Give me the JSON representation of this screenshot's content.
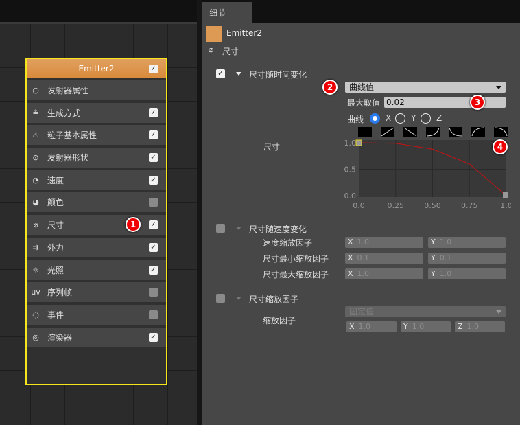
{
  "tab": "细节",
  "node": {
    "title": "Emitter2",
    "enabled": true,
    "modules": [
      {
        "icon": "circle-icon",
        "label": "发射器属性",
        "checkbox": null
      },
      {
        "icon": "sliders-icon",
        "label": "生成方式",
        "checkbox": true
      },
      {
        "icon": "flame-icon",
        "label": "粒子基本属性",
        "checkbox": true
      },
      {
        "icon": "location-pin-icon",
        "label": "发射器形状",
        "checkbox": true
      },
      {
        "icon": "speedometer-icon",
        "label": "速度",
        "checkbox": true
      },
      {
        "icon": "palette-icon",
        "label": "颜色",
        "checkbox": false
      },
      {
        "icon": "ruler-icon",
        "label": "尺寸",
        "checkbox": true,
        "badge": "1"
      },
      {
        "icon": "arrows-icon",
        "label": "外力",
        "checkbox": true
      },
      {
        "icon": "sun-icon",
        "label": "光照",
        "checkbox": true
      },
      {
        "icon": "uv-icon",
        "label": "序列帧",
        "checkbox": false
      },
      {
        "icon": "event-icon",
        "label": "事件",
        "checkbox": false
      },
      {
        "icon": "renderer-icon",
        "label": "渲染器",
        "checkbox": true
      }
    ]
  },
  "details": {
    "emitter_name": "Emitter2",
    "accent": "#dd9a55",
    "module_name": "尺寸",
    "size_over_time": {
      "label": "尺寸随时间变化",
      "enabled": true,
      "mode": "曲线值",
      "badge_mode": "2",
      "max_label": "最大取值",
      "max_value": "0.02",
      "badge_max": "3",
      "curve_label": "曲线",
      "axes": [
        "X",
        "Y",
        "Z"
      ],
      "selected_axis": "X",
      "field_label": "尺寸",
      "badge_curve": "4",
      "chart_data": {
        "type": "line",
        "x_ticks": [
          "0.0",
          "0.25",
          "0.50",
          "0.75",
          "1.0"
        ],
        "y_ticks": [
          "1.0",
          "0.5",
          "0.0"
        ],
        "xlim": [
          0,
          1
        ],
        "ylim": [
          0,
          1
        ],
        "x": [
          0,
          0.25,
          0.5,
          0.75,
          1.0
        ],
        "y": [
          1.0,
          0.99,
          0.88,
          0.6,
          0.0
        ],
        "color": "#cc1111"
      }
    },
    "size_by_speed": {
      "label": "尺寸随速度变化",
      "enabled": false,
      "rows": [
        {
          "label": "速度缩放因子",
          "x": "1.0",
          "y": "1.0"
        },
        {
          "label": "尺寸最小缩放因子",
          "x": "0.1",
          "y": "0.1"
        },
        {
          "label": "尺寸最大缩放因子",
          "x": "1.0",
          "y": "1.0"
        }
      ]
    },
    "size_scale": {
      "label": "尺寸缩放因子",
      "enabled": false,
      "field_label": "缩放因子",
      "mode": "固定值",
      "x": "1.0",
      "y": "1.0",
      "z": "1.0"
    }
  }
}
